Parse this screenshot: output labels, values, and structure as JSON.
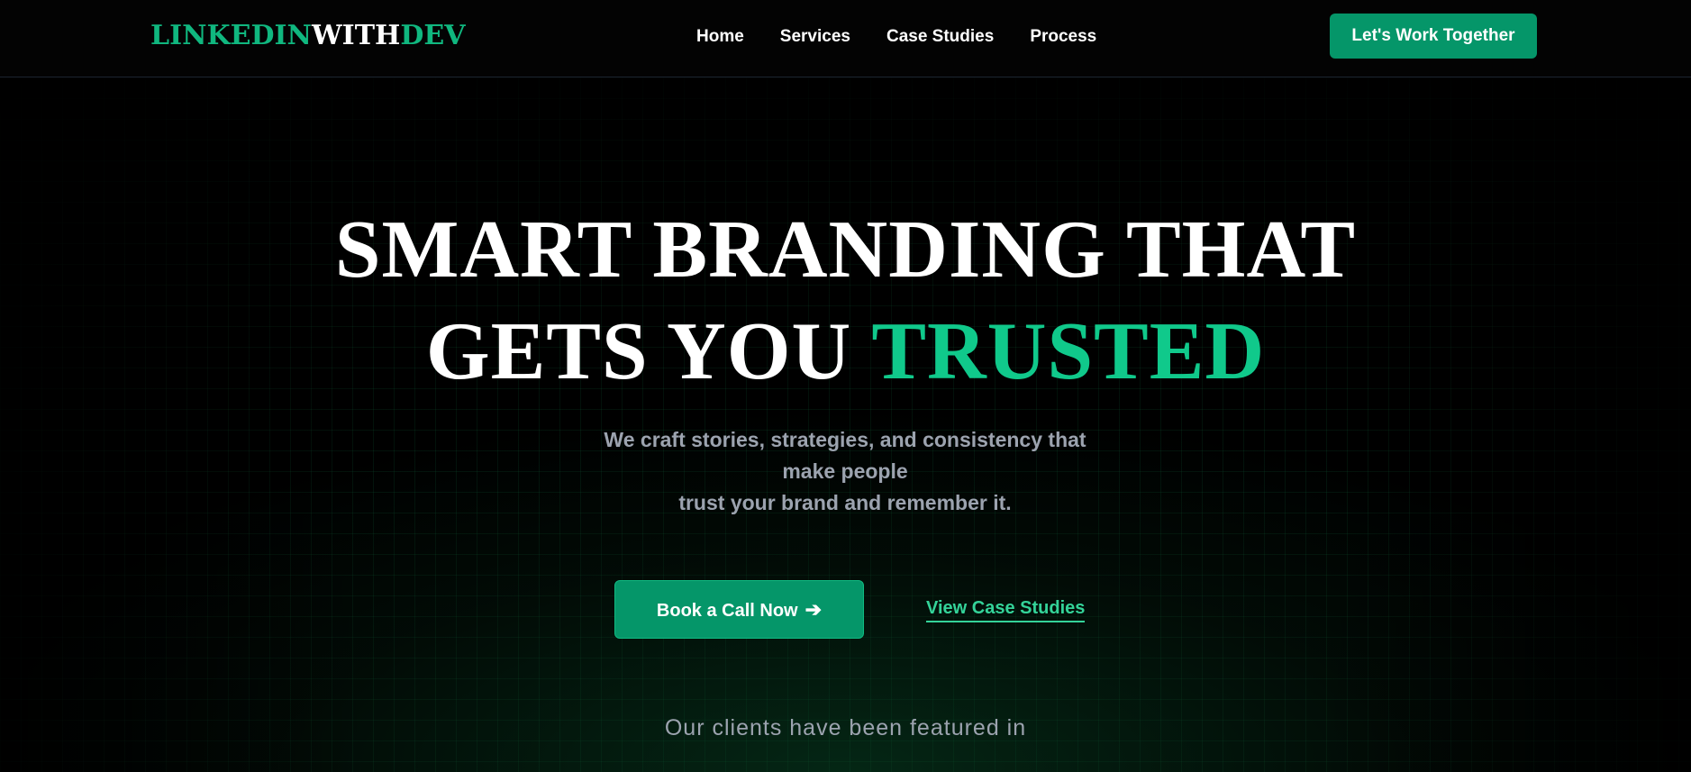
{
  "header": {
    "logo": {
      "part1": "LINKEDIN",
      "part2": "WITH",
      "part3": "DEV"
    },
    "nav": [
      {
        "label": "Home"
      },
      {
        "label": "Services"
      },
      {
        "label": "Case Studies"
      },
      {
        "label": "Process"
      }
    ],
    "cta_label": "Let's Work Together"
  },
  "hero": {
    "headline_line1": "SMART BRANDING THAT",
    "headline_line2_prefix": "GETS YOU ",
    "headline_line2_accent": "TRUSTED",
    "subtitle_line1": "We craft stories, strategies, and consistency that make people",
    "subtitle_line2": "trust your brand and remember it.",
    "primary_button_label": "Book a Call Now",
    "primary_button_icon": "arrow-right-icon",
    "secondary_link_label": "View Case Studies",
    "featured_text": "Our clients have been featured in"
  },
  "colors": {
    "background": "#000000",
    "accent": "#10b981",
    "accent_button": "#059669",
    "muted_text": "#9ca3af"
  }
}
